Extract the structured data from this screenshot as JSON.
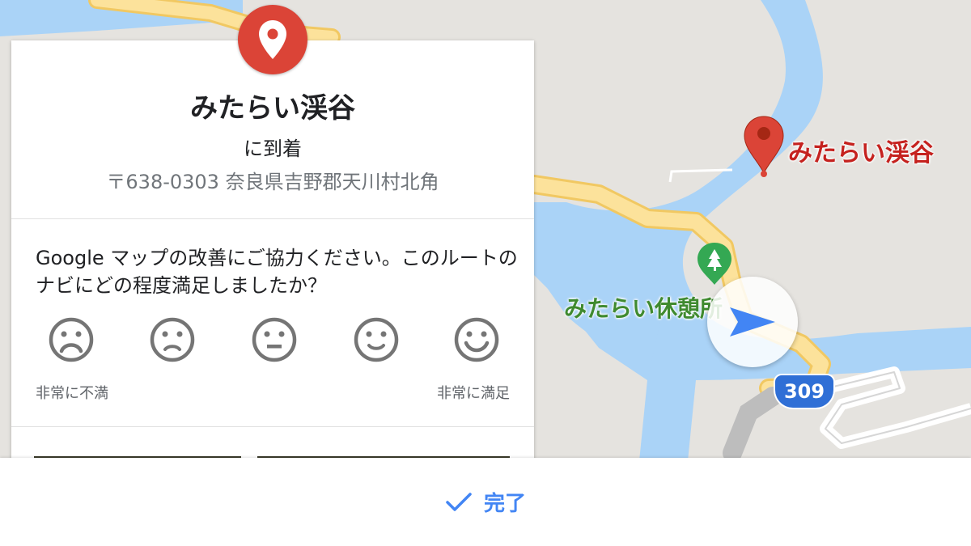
{
  "map": {
    "destination_label": "みたらい渓谷",
    "poi_label": "みたらい休憩所",
    "route_number": "309",
    "colors": {
      "water": "#aad3f7",
      "road": "#fce29b",
      "road_edge": "#f1c862",
      "land": "#e5e3df",
      "pin": "#db4437",
      "poi": "#3f8a2f",
      "nav_arrow": "#4285f4"
    },
    "icons": [
      "destination-pin-icon",
      "park-icon",
      "navigation-arrow-icon",
      "route-shield"
    ]
  },
  "card": {
    "title": "みたらい渓谷",
    "subtitle": "に到着",
    "address": "〒638-0303 奈良県吉野郡天川村北角",
    "survey_question": "Google マップの改善にご協力ください。このルートのナビにどの程度満足しましたか？",
    "ratings": [
      {
        "name": "very-dissatisfied",
        "icon": "very-dissatisfied-face-icon"
      },
      {
        "name": "dissatisfied",
        "icon": "dissatisfied-face-icon"
      },
      {
        "name": "neutral",
        "icon": "neutral-face-icon"
      },
      {
        "name": "satisfied",
        "icon": "satisfied-face-icon"
      },
      {
        "name": "very-satisfied",
        "icon": "very-satisfied-face-icon"
      }
    ],
    "scale_low": "非常に不満",
    "scale_high": "非常に満足"
  },
  "footer": {
    "done_label": "完了",
    "done_icon": "checkmark-icon"
  }
}
